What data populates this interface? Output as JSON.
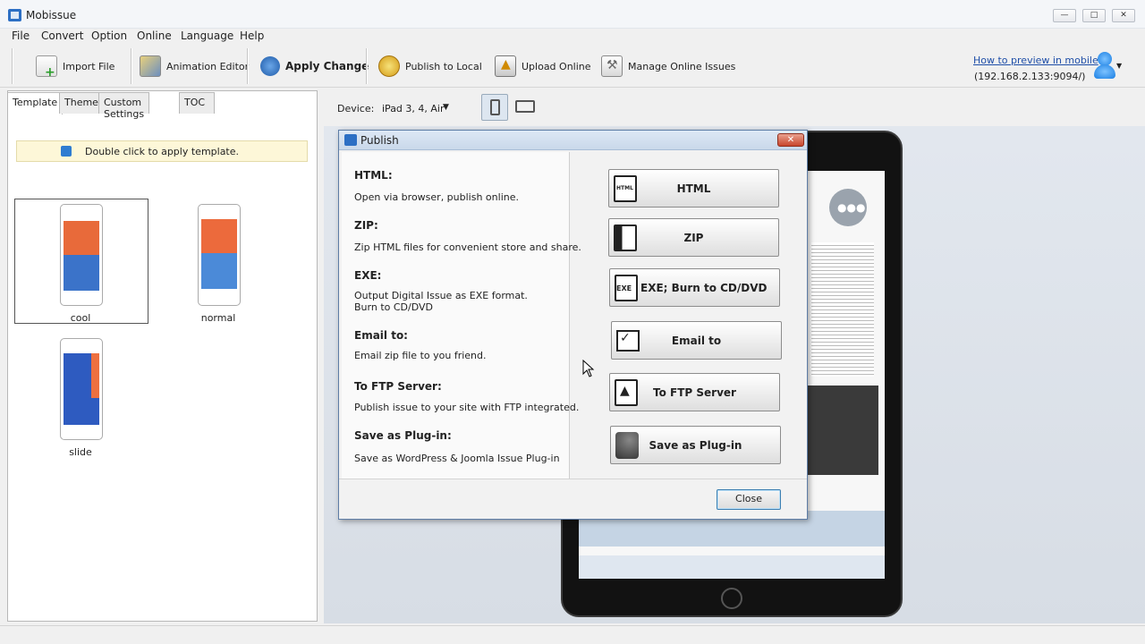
{
  "window": {
    "title": "Mobissue",
    "min_icon": "minimize-icon",
    "max_icon": "maximize-icon",
    "close_icon": "close-icon"
  },
  "menu": [
    "File",
    "Convert",
    "Option",
    "Online",
    "Language",
    "Help"
  ],
  "toolbar": {
    "import_file": "Import File",
    "animation_editor": "Animation Editor",
    "apply_change": "Apply Change",
    "publish_local": "Publish to Local",
    "upload_online": "Upload Online",
    "manage_online": "Manage Online Issues"
  },
  "preview": {
    "link": "How to preview in mobile",
    "ip": "(192.168.2.133:9094/)"
  },
  "left_panel": {
    "tabs": [
      "Template",
      "Theme",
      "Custom Settings",
      "TOC"
    ],
    "hint": "Double click to apply template.",
    "templates": [
      "cool",
      "normal",
      "slide"
    ]
  },
  "device": {
    "label": "Device:",
    "value": "iPad 3, 4, Air"
  },
  "dialog": {
    "title": "Publish",
    "items": [
      {
        "heading": "HTML:",
        "desc": "Open via browser, publish online.",
        "button": "HTML",
        "icon": "html-file-icon"
      },
      {
        "heading": "ZIP:",
        "desc": "Zip HTML files for convenient store and share.",
        "button": "ZIP",
        "icon": "zip-file-icon"
      },
      {
        "heading": "EXE:",
        "desc": "Output Digital Issue as EXE format.",
        "desc2": "Burn to CD/DVD",
        "button": "EXE; Burn to CD/DVD",
        "icon": "exe-file-icon"
      },
      {
        "heading": "Email to:",
        "desc": "Email zip file to you friend.",
        "button": "Email to",
        "icon": "email-icon"
      },
      {
        "heading": "To FTP Server:",
        "desc": "Publish issue to your site with FTP integrated.",
        "button": "To FTP Server",
        "icon": "ftp-upload-icon"
      },
      {
        "heading": "Save as Plug-in:",
        "desc": "Save as WordPress & Joomla Issue Plug-in",
        "button": "Save as Plug-in",
        "icon": "puzzle-plugin-icon"
      }
    ],
    "close": "Close"
  },
  "colors": {
    "accent": "#2c6fc4",
    "link": "#1f4fa8",
    "hint_bg": "#fdf7d8"
  }
}
